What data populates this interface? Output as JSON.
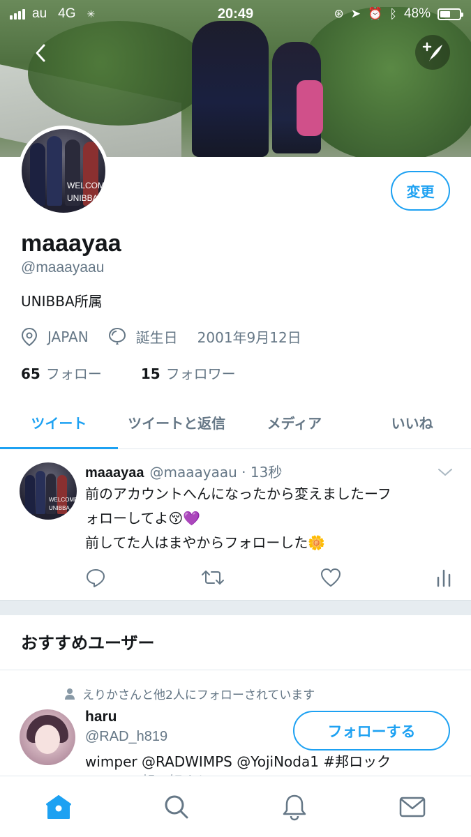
{
  "status_bar": {
    "carrier": "au",
    "network": "4G",
    "time": "20:49",
    "battery": "48%"
  },
  "profile": {
    "display_name": "maaayaa",
    "handle": "@maaayaau",
    "bio": "UNIBBA所属",
    "location": "JAPAN",
    "birthday_label": "誕生日",
    "birthday": "2001年9月12日",
    "following_count": "65",
    "following_label": "フォロー",
    "followers_count": "15",
    "followers_label": "フォロワー",
    "edit_label": "変更",
    "avatar_text": "WELCOME\nUNIBBA"
  },
  "tabs": [
    {
      "label": "ツイート",
      "active": true
    },
    {
      "label": "ツイートと返信",
      "active": false
    },
    {
      "label": "メディア",
      "active": false
    },
    {
      "label": "いいね",
      "active": false
    }
  ],
  "tweet": {
    "name": "maaayaa",
    "handle_time": "@maaayaau · 13秒",
    "line1": "前のアカウントへんになったから変えましたーフ",
    "line2": "ォローしてよ😚💜",
    "line3": "前してた人はまやからフォローした🌼"
  },
  "recommended": {
    "title": "おすすめユーザー",
    "social_context": "えりかさんと他2人にフォローされています",
    "user": {
      "name": "haru",
      "handle": "@RAD_h819",
      "bio": "wimper @RADWIMPS @YojiNoda1 #邦ロック",
      "bio_cont": "#ｗｗ #邦ロ好きと"
    },
    "follow_label": "フォローする"
  },
  "colors": {
    "accent": "#1da1f2",
    "secondary_text": "#657786",
    "separator": "#e6ecf0"
  },
  "icons": {
    "back": "chevron-left-icon",
    "compose": "compose-quill-icon",
    "location": "location-pin-icon",
    "birthday": "balloon-icon",
    "reply": "reply-icon",
    "retweet": "retweet-icon",
    "like": "heart-icon",
    "analytics": "analytics-icon",
    "home": "home-icon",
    "search": "search-icon",
    "notifications": "bell-icon",
    "messages": "mail-icon"
  }
}
